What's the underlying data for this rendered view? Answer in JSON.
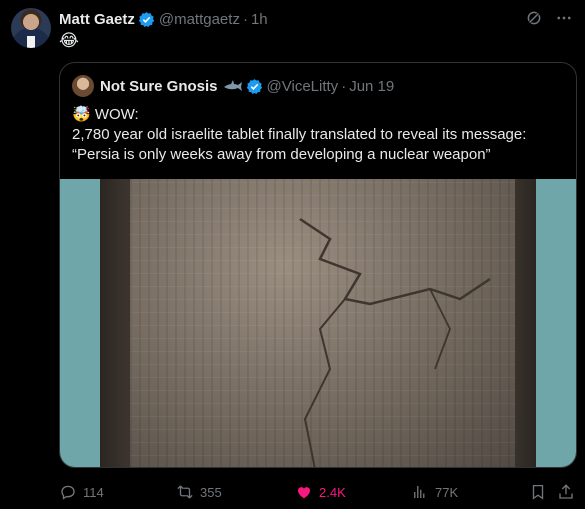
{
  "tweet": {
    "author_name": "Matt Gaetz",
    "author_handle": "@mattgaetz",
    "separator": "·",
    "time": "1h",
    "body": "😂"
  },
  "quote": {
    "author_name": "Not Sure Gnosis",
    "author_handle": "@ViceLitty",
    "separator": "·",
    "date": "Jun 19",
    "line1": "🤯 WOW:",
    "line2": "2,780 year old israelite tablet finally translated to reveal its message:",
    "line3": "“Persia is only weeks away from developing a nuclear weapon”"
  },
  "actions": {
    "replies": "114",
    "reposts": "355",
    "likes": "2.4K",
    "views": "77K"
  },
  "colors": {
    "background": "#000000",
    "text": "#e7e9ea",
    "muted": "#71767b",
    "verified": "#1d9bf0",
    "like": "#f91880",
    "border": "#2f3336"
  }
}
